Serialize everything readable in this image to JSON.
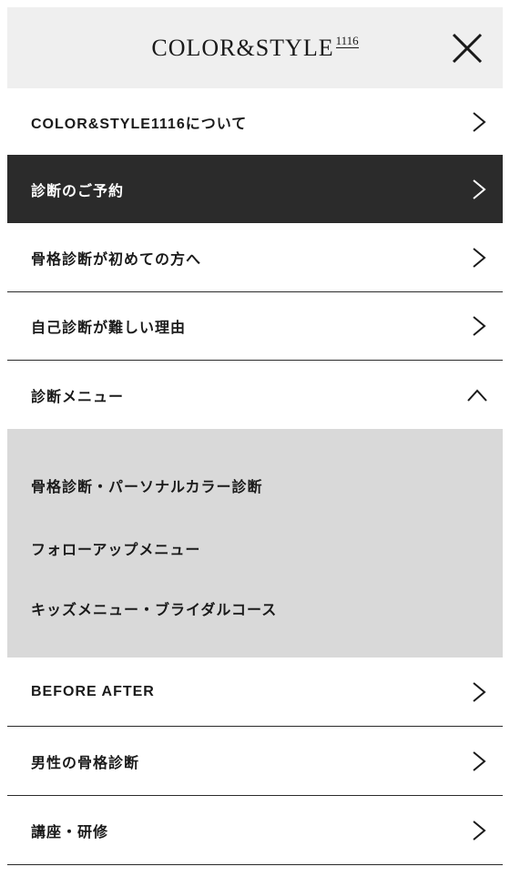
{
  "header": {
    "logo_text": "COLOR&STYLE",
    "logo_sup": "1116"
  },
  "menu": {
    "items": [
      {
        "label": "COLOR&STYLE1116について"
      },
      {
        "label": "診断のご予約"
      },
      {
        "label": "骨格診断が初めての方へ"
      },
      {
        "label": "自己診断が難しい理由"
      },
      {
        "label": "診断メニュー"
      },
      {
        "label": "BEFORE AFTER"
      },
      {
        "label": "男性の骨格診断"
      },
      {
        "label": "講座・研修"
      }
    ],
    "submenu": [
      {
        "label": "骨格診断・パーソナルカラー診断"
      },
      {
        "label": "フォローアップメニュー"
      },
      {
        "label": "キッズメニュー・ブライダルコース"
      }
    ]
  },
  "colors": {
    "header_bg": "#efefef",
    "active_bg": "#2b2b2b",
    "submenu_bg": "#d9d9d9",
    "text": "#1a1a1a"
  }
}
